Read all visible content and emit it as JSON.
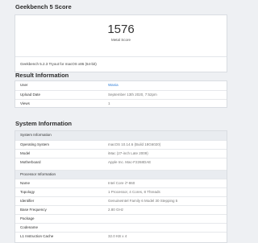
{
  "score_section": {
    "title": "Geekbench 5 Score",
    "score": "1576",
    "score_label": "Metal Score",
    "footer": "Geekbench 5.2.3 Tryout for macOS x86 (64-bit)"
  },
  "result_info": {
    "title": "Result Information",
    "rows": [
      {
        "key": "User",
        "value": "Wania"
      },
      {
        "key": "Upload Date",
        "value": "September 13th 2020, 7:52pm"
      },
      {
        "key": "Views",
        "value": "1"
      }
    ]
  },
  "system_info": {
    "title": "System Information",
    "group1": {
      "label": "System Information"
    },
    "rows1": [
      {
        "key": "Operating System",
        "value": "macOS 10.14.6 (Build 18G6020)"
      },
      {
        "key": "Model",
        "value": "iMac (27-inch Late 2009)"
      },
      {
        "key": "Motherboard",
        "value": "Apple Inc. Mac-F2268DAE"
      }
    ],
    "group2": {
      "label": "Processor Information"
    },
    "rows2": [
      {
        "key": "Name",
        "value": "Intel Core i7-860"
      },
      {
        "key": "Topology",
        "value": "1 Processor, 4 Cores, 8 Threads"
      },
      {
        "key": "Identifier",
        "value": "GenuineIntel Family 6 Model 30 Stepping 5"
      },
      {
        "key": "Base Frequency",
        "value": "2.80 GHz"
      },
      {
        "key": "Package",
        "value": ""
      },
      {
        "key": "Codename",
        "value": ""
      },
      {
        "key": "L1 Instruction Cache",
        "value": "32.0 KB x 4"
      }
    ]
  }
}
